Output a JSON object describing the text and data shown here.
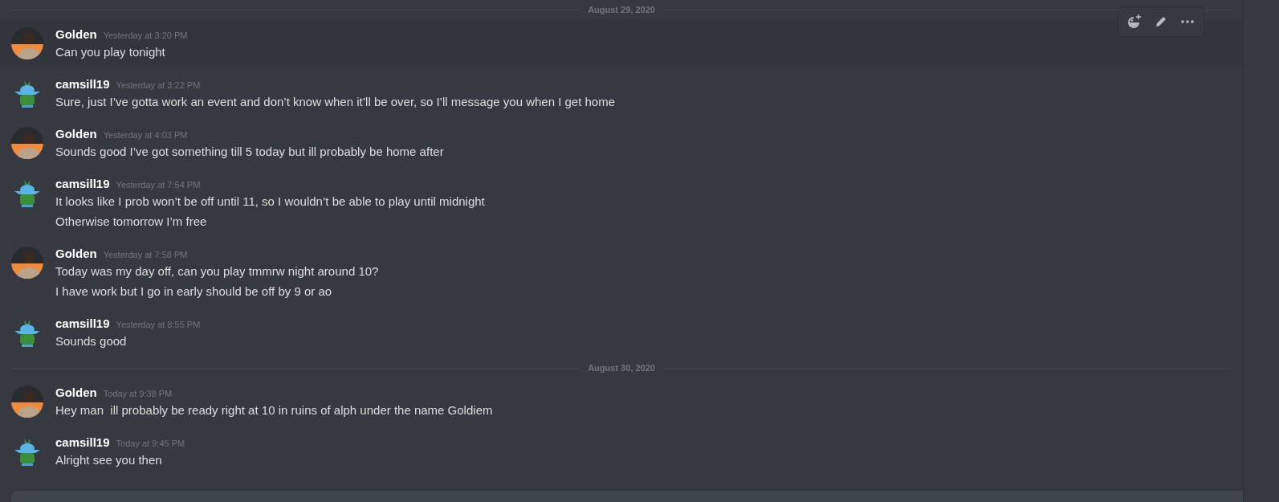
{
  "feed": [
    {
      "kind": "divider",
      "label": "August 29, 2020"
    },
    {
      "kind": "group",
      "author": "Golden",
      "avatar": {
        "kind": "person"
      },
      "time": "Yesterday at 3:20 PM",
      "hovered": true,
      "lines": [
        "Can you play tonight"
      ]
    },
    {
      "kind": "group",
      "author": "camsill19",
      "avatar": {
        "kind": "creature"
      },
      "time": "Yesterday at 3:22 PM",
      "hovered": false,
      "lines": [
        "Sure, just I’ve gotta work an event and don’t know when it’ll be over, so I’ll message you when I get home"
      ]
    },
    {
      "kind": "group",
      "author": "Golden",
      "avatar": {
        "kind": "person"
      },
      "time": "Yesterday at 4:03 PM",
      "hovered": false,
      "lines": [
        "Sounds good I’ve got something till 5 today but ill probably be home after"
      ]
    },
    {
      "kind": "group",
      "author": "camsill19",
      "avatar": {
        "kind": "creature"
      },
      "time": "Yesterday at 7:54 PM",
      "hovered": false,
      "lines": [
        "It looks like I prob won’t be off until 11, so I wouldn’t be able to play until midnight",
        "Otherwise tomorrow I’m free"
      ]
    },
    {
      "kind": "group",
      "author": "Golden",
      "avatar": {
        "kind": "person"
      },
      "time": "Yesterday at 7:58 PM",
      "hovered": false,
      "lines": [
        "Today was my day off, can you play tmmrw night around 10?",
        "I have work but I go in early should be off by 9 or ao"
      ]
    },
    {
      "kind": "group",
      "author": "camsill19",
      "avatar": {
        "kind": "creature"
      },
      "time": "Yesterday at 8:55 PM",
      "hovered": false,
      "lines": [
        "Sounds good"
      ]
    },
    {
      "kind": "divider",
      "label": "August 30, 2020"
    },
    {
      "kind": "group",
      "author": "Golden",
      "avatar": {
        "kind": "person"
      },
      "time": "Today at 9:38 PM",
      "hovered": false,
      "lines": [
        "Hey man  ill probably be ready right at 10 in ruins of alph under the name Goldiem"
      ]
    },
    {
      "kind": "group",
      "author": "camsill19",
      "avatar": {
        "kind": "creature"
      },
      "time": "Today at 9:45 PM",
      "hovered": false,
      "lines": [
        "Alright see you then"
      ]
    }
  ]
}
